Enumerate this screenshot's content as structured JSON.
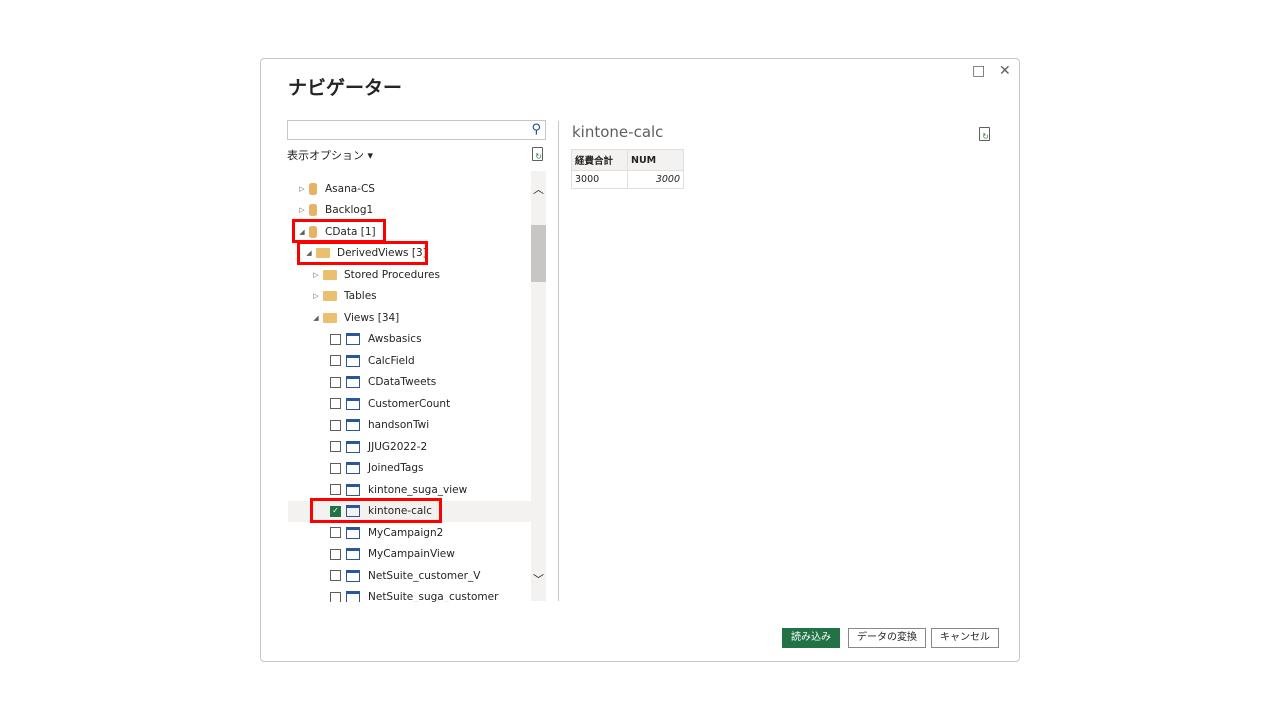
{
  "dialog": {
    "title": "ナビゲーター",
    "maximize_icon": "□",
    "close_icon": "✕"
  },
  "left": {
    "search_placeholder": "",
    "options_label": "表示オプション ▾",
    "items": [
      {
        "label": "Asana-CS",
        "type": "db",
        "arrow": "▷",
        "indent": 0
      },
      {
        "label": "Backlog1",
        "type": "db",
        "arrow": "▷",
        "indent": 0
      },
      {
        "label": "CData [1]",
        "type": "db",
        "arrow": "◢",
        "indent": 0
      },
      {
        "label": "DerivedViews [3]",
        "type": "folder",
        "arrow": "◢",
        "indent": 1
      },
      {
        "label": "Stored Procedures",
        "type": "folder",
        "arrow": "▷",
        "indent": 2
      },
      {
        "label": "Tables",
        "type": "folder",
        "arrow": "▷",
        "indent": 2
      },
      {
        "label": "Views [34]",
        "type": "folder",
        "arrow": "◢",
        "indent": 2
      },
      {
        "label": "Awsbasics",
        "type": "view",
        "checked": false
      },
      {
        "label": "CalcField",
        "type": "view",
        "checked": false
      },
      {
        "label": "CDataTweets",
        "type": "view",
        "checked": false
      },
      {
        "label": "CustomerCount",
        "type": "view",
        "checked": false
      },
      {
        "label": "handsonTwi",
        "type": "view",
        "checked": false
      },
      {
        "label": "JJUG2022-2",
        "type": "view",
        "checked": false
      },
      {
        "label": "JoinedTags",
        "type": "view",
        "checked": false
      },
      {
        "label": "kintone_suga_view",
        "type": "view",
        "checked": false
      },
      {
        "label": "kintone-calc",
        "type": "view",
        "checked": true
      },
      {
        "label": "MyCampaign2",
        "type": "view",
        "checked": false
      },
      {
        "label": "MyCampainView",
        "type": "view",
        "checked": false
      },
      {
        "label": "NetSuite_customer_V",
        "type": "view",
        "checked": false
      },
      {
        "label": "NetSuite_suga_customer",
        "type": "view",
        "checked": false
      }
    ]
  },
  "preview": {
    "title": "kintone-calc",
    "columns": [
      "経費合計",
      "NUM"
    ],
    "rows": [
      [
        "3000",
        "3000"
      ]
    ]
  },
  "buttons": {
    "load": "読み込み",
    "transform": "データの変換",
    "cancel": "キャンセル"
  },
  "colors": {
    "accent": "#217346",
    "highlight": "#ff0000"
  }
}
